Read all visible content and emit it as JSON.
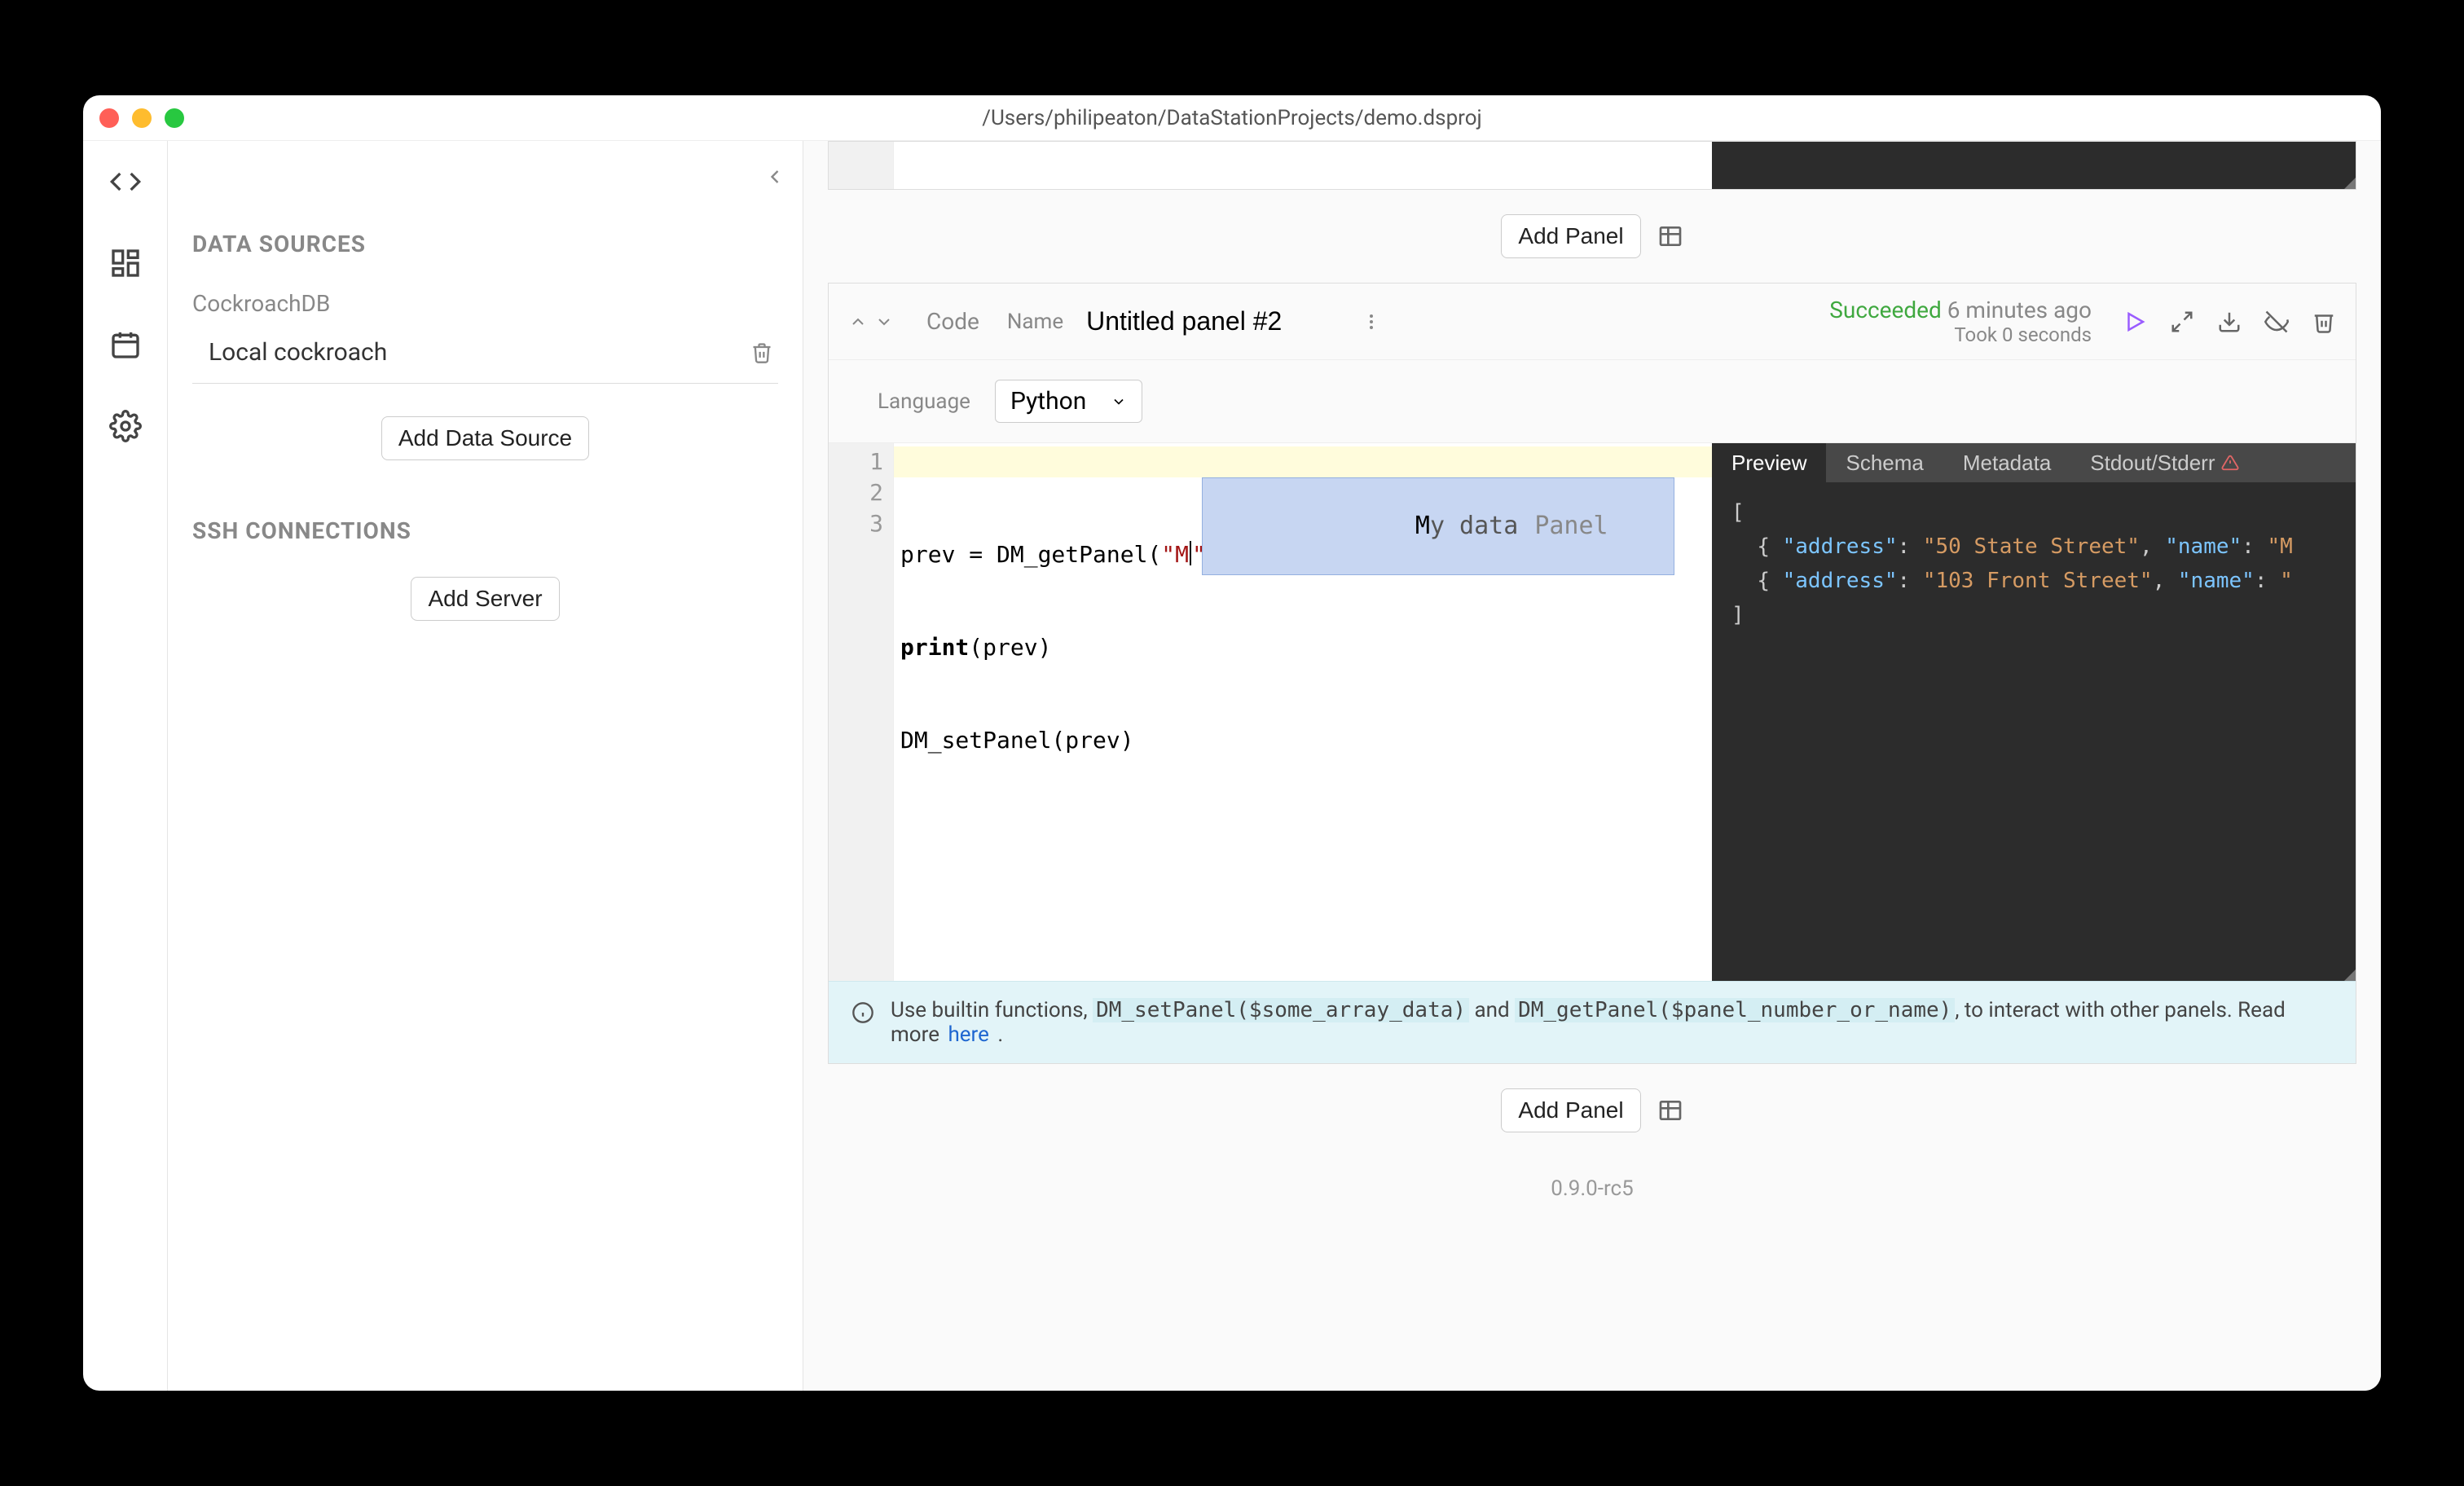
{
  "window": {
    "title": "/Users/philipeaton/DataStationProjects/demo.dsproj"
  },
  "sidebar": {
    "data_sources_header": "DATA SOURCES",
    "ds_type_label": "CockroachDB",
    "ds_item_name": "Local cockroach",
    "add_ds_label": "Add Data Source",
    "ssh_header": "SSH CONNECTIONS",
    "add_server_label": "Add Server"
  },
  "add_panel_label": "Add Panel",
  "panel": {
    "type_label": "Code",
    "name_label": "Name",
    "name_value": "Untitled panel #2",
    "status_ok": "Succeeded",
    "status_ago": "6 minutes ago",
    "status_took": "Took 0 seconds",
    "language_label": "Language",
    "language_value": "Python",
    "code": {
      "line1_a": "prev = DM_getPanel(",
      "line1_str_open": "\"",
      "line1_str_content": "M",
      "line1_str_close": "\"",
      "line1_b": ")",
      "line2": "print(prev)",
      "line3": "DM_setPanel(prev)"
    },
    "autocomplete": {
      "match_prefix": "M",
      "match_rest": "y data",
      "hint": "Panel"
    },
    "tabs": {
      "preview": "Preview",
      "schema": "Schema",
      "metadata": "Metadata",
      "stdout": "Stdout/Stderr"
    },
    "preview_json": {
      "rows": [
        {
          "address": "50 State Street",
          "name_cut": "\"M"
        },
        {
          "address": "103 Front Street",
          "name_cut": "\""
        }
      ]
    },
    "info": {
      "t1": "Use builtin functions, ",
      "c1": "DM_setPanel($some_array_data)",
      "t2": " and ",
      "c2": "DM_getPanel($panel_number_or_name)",
      "t3": ", to interact with other panels. Read more ",
      "link": "here",
      "t4": " ."
    }
  },
  "version": "0.9.0-rc5"
}
